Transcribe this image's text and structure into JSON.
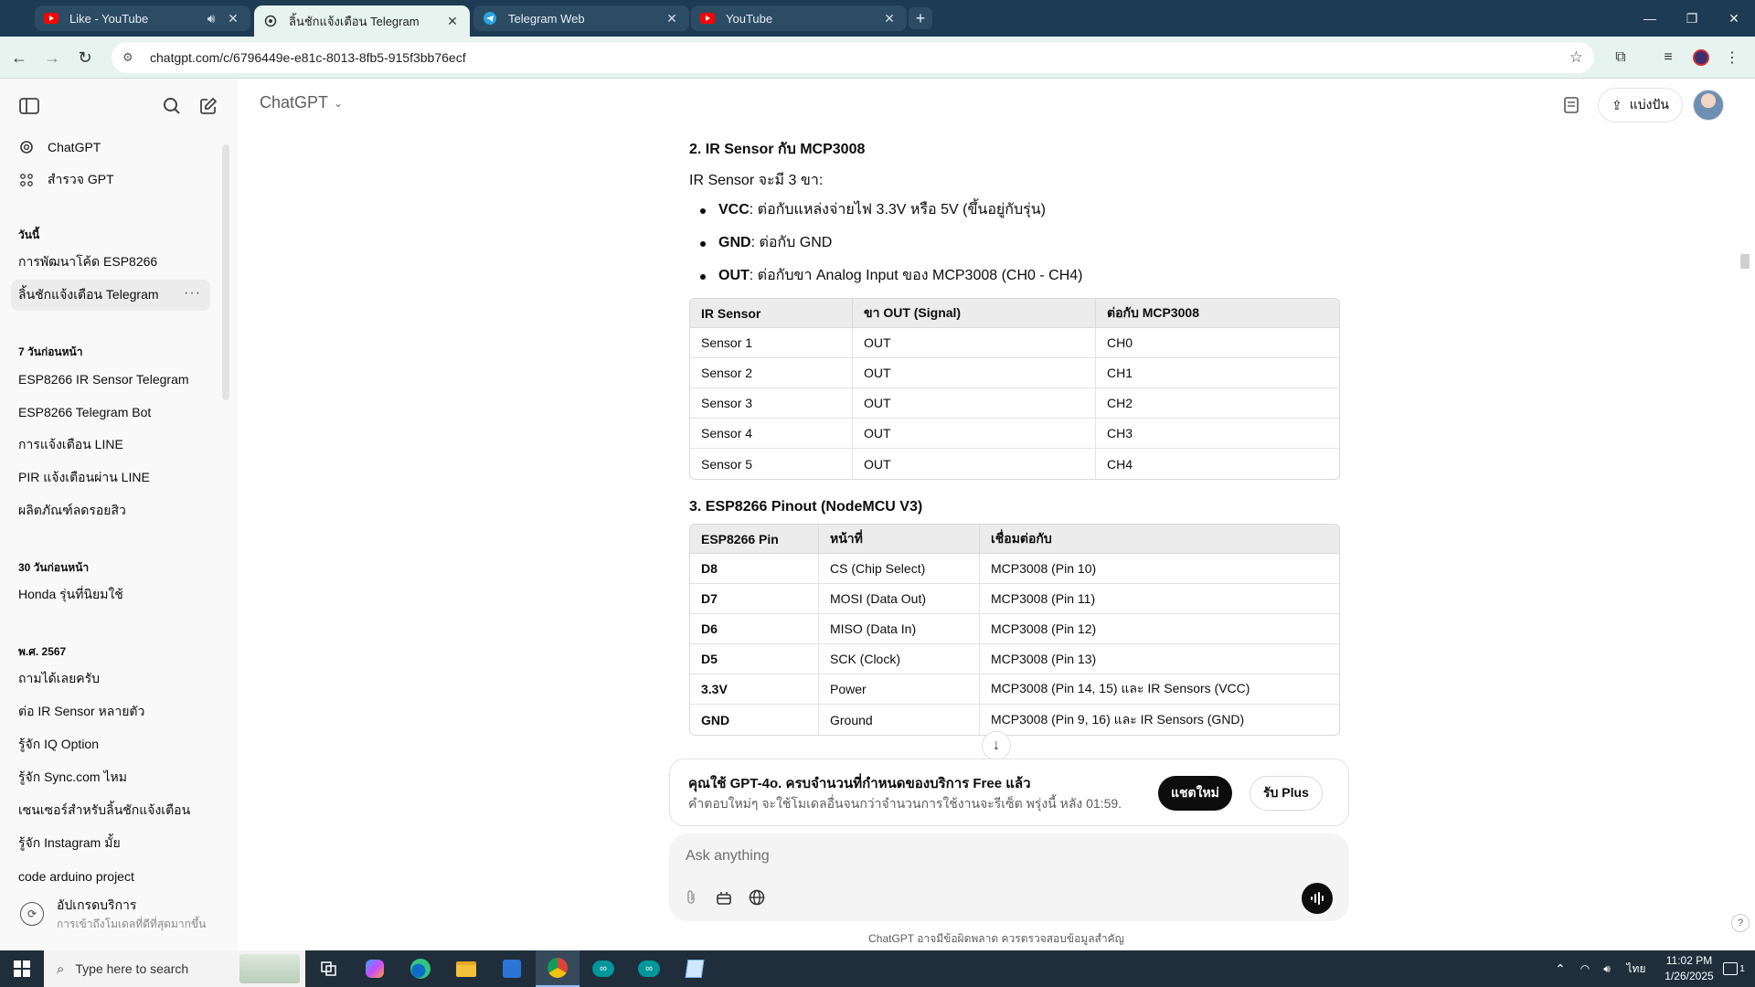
{
  "browser": {
    "tabs": [
      {
        "title": "Like - YouTube",
        "icon": "youtube-icon",
        "audio": true
      },
      {
        "title": "ลิ้นชักแจ้งเตือน Telegram",
        "icon": "chatgpt-icon",
        "active": true
      },
      {
        "title": "Telegram Web",
        "icon": "telegram-icon"
      },
      {
        "title": "YouTube",
        "icon": "youtube-icon"
      }
    ],
    "url": "chatgpt.com/c/6796449e-e81c-8013-8fb5-915f3bb76ecf"
  },
  "sidebar": {
    "top_items": [
      {
        "label": "ChatGPT",
        "icon": "chatgpt-logo-icon"
      },
      {
        "label": "สำรวจ GPT",
        "icon": "grid-icon"
      }
    ],
    "groups": [
      {
        "heading": "วันนี้",
        "items": [
          "การพัฒนาโค้ด ESP8266",
          "ลิ้นชักแจ้งเตือน Telegram"
        ]
      },
      {
        "heading": "7 วันก่อนหน้า",
        "items": [
          "ESP8266 IR Sensor Telegram",
          "ESP8266 Telegram Bot",
          "การแจ้งเตือน LINE",
          "PIR แจ้งเตือนผ่าน LINE",
          "ผลิตภัณฑ์ลดรอยสิว"
        ]
      },
      {
        "heading": "30 วันก่อนหน้า",
        "items": [
          "Honda รุ่นที่นิยมใช้"
        ]
      },
      {
        "heading": "พ.ศ. 2567",
        "items": [
          "ถามได้เลยครับ",
          "ต่อ IR Sensor หลายตัว",
          "รู้จัก IQ Option",
          "รู้จัก Sync.com ไหม",
          "เซนเซอร์สำหรับลิ้นชักแจ้งเตือน",
          "รู้จัก Instagram มั้ย",
          "code arduino project"
        ]
      }
    ],
    "selected_item": "ลิ้นชักแจ้งเตือน Telegram",
    "upgrade": {
      "title": "อัปเกรดบริการ",
      "subtitle": "การเข้าถึงโมเดลที่ดีที่สุดมากขึ้น"
    }
  },
  "header": {
    "model": "ChatGPT",
    "share_label": "แบ่งปัน"
  },
  "message": {
    "section2_title": "2. IR Sensor กับ MCP3008",
    "section2_intro": "IR Sensor จะมี 3 ขา:",
    "pins": [
      {
        "name": "VCC",
        "desc": ": ต่อกับแหล่งจ่ายไฟ 3.3V หรือ 5V (ขึ้นอยู่กับรุ่น)"
      },
      {
        "name": "GND",
        "desc": ": ต่อกับ GND"
      },
      {
        "name": "OUT",
        "desc": ": ต่อกับขา Analog Input ของ MCP3008 (CH0 - CH4)"
      }
    ],
    "table1": {
      "headers": [
        "IR Sensor",
        "ขา OUT (Signal)",
        "ต่อกับ MCP3008"
      ],
      "rows": [
        [
          "Sensor 1",
          "OUT",
          "CH0"
        ],
        [
          "Sensor 2",
          "OUT",
          "CH1"
        ],
        [
          "Sensor 3",
          "OUT",
          "CH2"
        ],
        [
          "Sensor 4",
          "OUT",
          "CH3"
        ],
        [
          "Sensor 5",
          "OUT",
          "CH4"
        ]
      ]
    },
    "section3_title": "3. ESP8266 Pinout (NodeMCU V3)",
    "table2": {
      "headers": [
        "ESP8266 Pin",
        "หน้าที่",
        "เชื่อมต่อกับ"
      ],
      "rows": [
        [
          "D8",
          "CS (Chip Select)",
          "MCP3008 (Pin 10)"
        ],
        [
          "D7",
          "MOSI (Data Out)",
          "MCP3008 (Pin 11)"
        ],
        [
          "D6",
          "MISO (Data In)",
          "MCP3008 (Pin 12)"
        ],
        [
          "D5",
          "SCK (Clock)",
          "MCP3008 (Pin 13)"
        ],
        [
          "3.3V",
          "Power",
          "MCP3008 (Pin 14, 15) และ IR Sensors (VCC)"
        ],
        [
          "GND",
          "Ground",
          "MCP3008 (Pin 9, 16) และ IR Sensors (GND)"
        ]
      ]
    }
  },
  "limit_notice": {
    "title": "คุณใช้ GPT-4o. ครบจำนวนที่กำหนดของบริการ Free แล้ว",
    "body": "คำตอบใหม่ๆ จะใช้โมเดลอื่นจนกว่าจำนวนการใช้งานจะรีเซ็ต พรุ่งนี้ หลัง 01:59.",
    "new_chat": "แชตใหม่",
    "get_plus": "รับ Plus"
  },
  "composer": {
    "placeholder": "Ask anything"
  },
  "disclaimer": "ChatGPT อาจมีข้อผิดพลาด ควรตรวจสอบข้อมูลสำคัญ",
  "taskbar": {
    "search_placeholder": "Type here to search",
    "language": "ไทย",
    "time": "11:02 PM",
    "date": "1/26/2025",
    "notification_count": "1"
  },
  "colors": {
    "tabstrip": "#1d3b52",
    "toolbar": "#e6f3ef",
    "sidebar": "#f9f9f9",
    "accent_dark": "#0d0d0d"
  }
}
